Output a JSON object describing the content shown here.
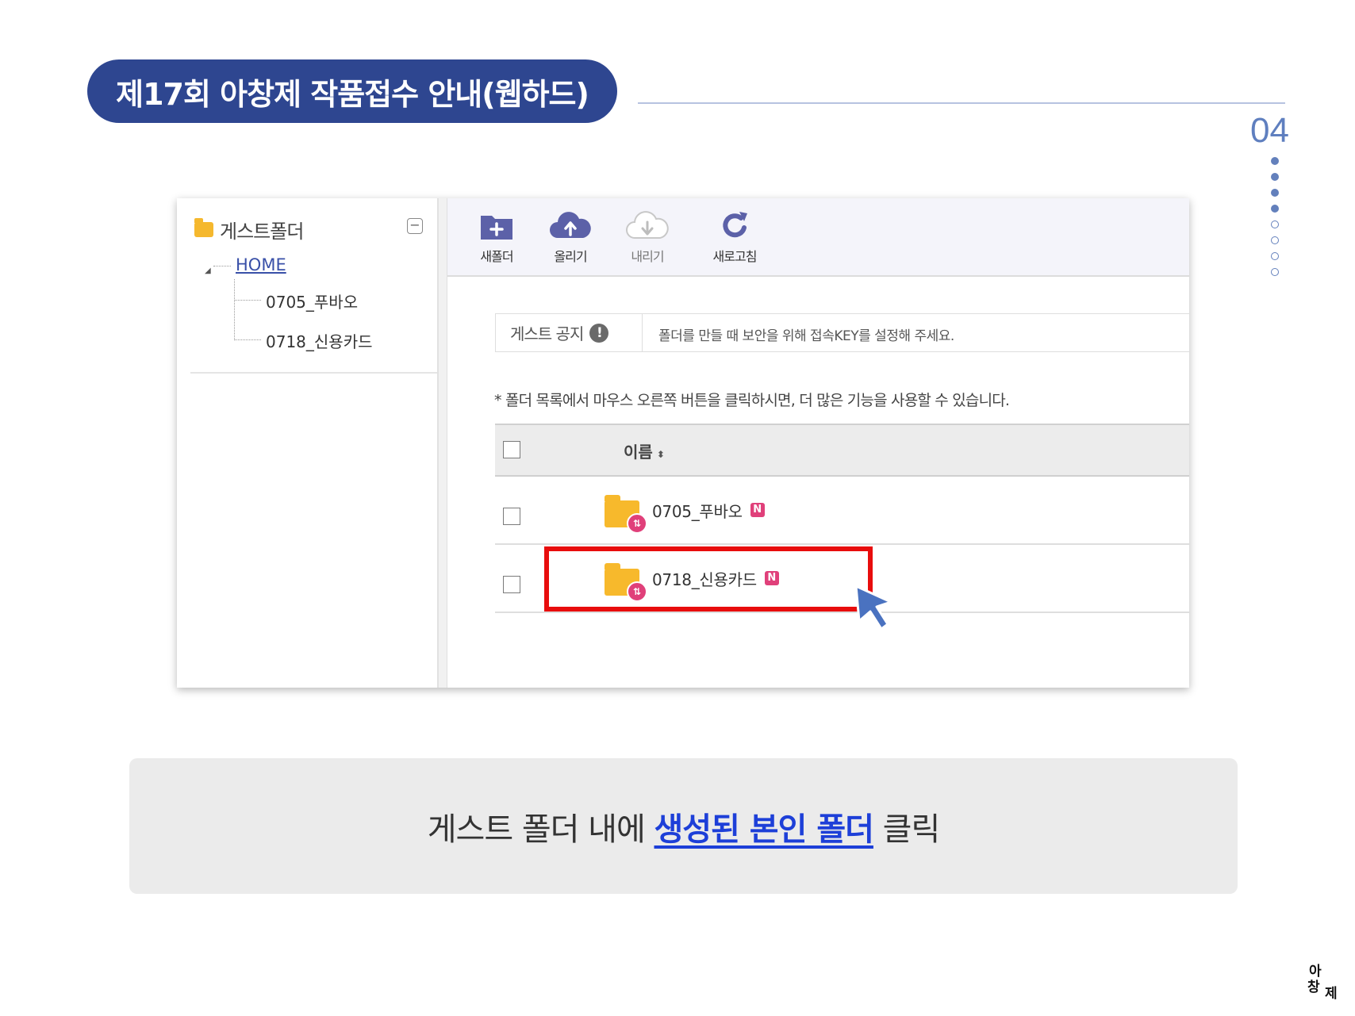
{
  "slide": {
    "title": "제17회 아창제 작품접수 안내(웹하드)",
    "page_number": "04",
    "progress": {
      "total_steps": 8,
      "current_step": 4
    },
    "accent_color": "#2e4690"
  },
  "tree": {
    "title": "게스트폴더",
    "home": "HOME",
    "items": [
      "0705_푸바오",
      "0718_신용카드"
    ]
  },
  "toolbar": {
    "new_folder": "새폴더",
    "upload": "올리기",
    "download": "내리기",
    "refresh": "새로고침"
  },
  "notice": {
    "label": "게스트 공지",
    "mark": "!",
    "text": "폴더를 만들 때 보안을 위해 접속KEY를 설정해 주세요."
  },
  "hint": "* 폴더 목록에서 마우스 오른쪽 버튼을 클릭하시면, 더 많은 기능을 사용할 수 있습니다.",
  "file_table": {
    "column_name": "이름",
    "sort_icon": "◆",
    "rows": [
      {
        "name": "0705_푸바오",
        "badge": "N",
        "highlighted": false
      },
      {
        "name": "0718_신용카드",
        "badge": "N",
        "highlighted": true
      }
    ]
  },
  "caption": {
    "before": "게스트 폴더 내에 ",
    "emphasis": "생성된 본인 폴더",
    "after": " 클릭"
  },
  "logo_text": "아창제",
  "colors": {
    "highlight": "#e80d0d",
    "caption_emphasis": "#1d3fd8",
    "new_badge": "#e0407a",
    "cursor": "#4a72c0"
  }
}
